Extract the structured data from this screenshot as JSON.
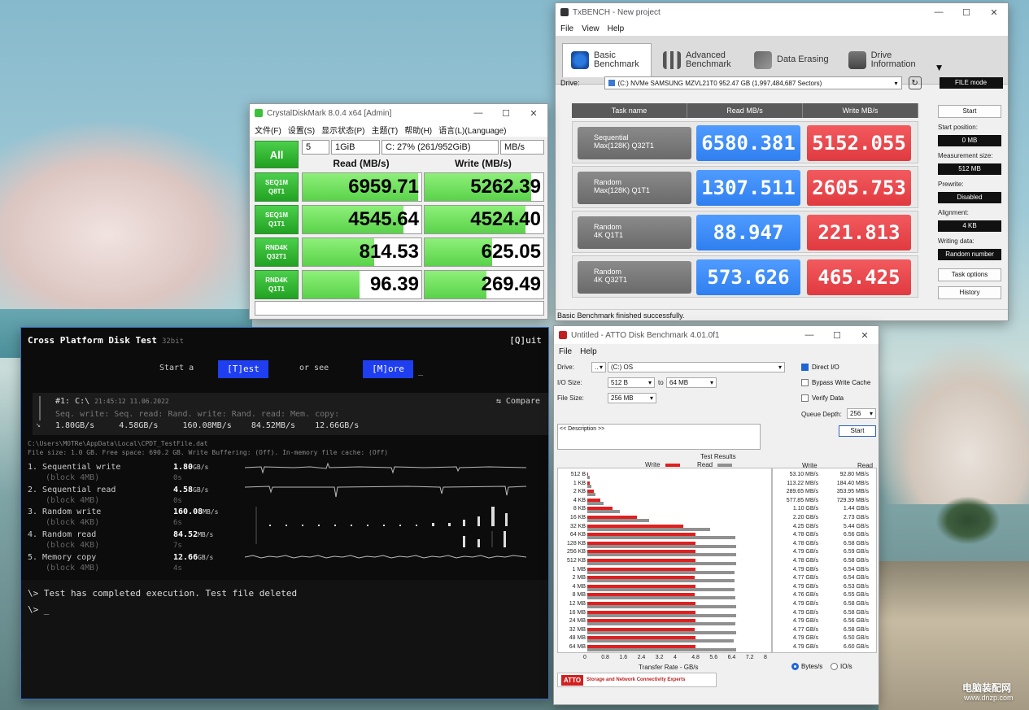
{
  "txbench": {
    "title": "TxBENCH - New project",
    "menu": [
      "File",
      "View",
      "Help"
    ],
    "tabs": [
      "Basic Benchmark",
      "Advanced Benchmark",
      "Data Erasing",
      "Drive Information"
    ],
    "drive_label": "Drive:",
    "drive_value": "(C:) NVMe SAMSUNG MZVL21T0  952.47 GB (1,997,484,687 Sectors)",
    "mode": "FILE mode",
    "headers": [
      "Task name",
      "Read MB/s",
      "Write MB/s"
    ],
    "rows": [
      {
        "name1": "Sequential",
        "name2": "Max(128K) Q32T1",
        "read": "6580.381",
        "write": "5152.055"
      },
      {
        "name1": "Random",
        "name2": "Max(128K) Q1T1",
        "read": "1307.511",
        "write": "2605.753"
      },
      {
        "name1": "Random",
        "name2": "4K Q1T1",
        "read": "88.947",
        "write": "221.813"
      },
      {
        "name1": "Random",
        "name2": "4K Q32T1",
        "read": "573.626",
        "write": "465.425"
      }
    ],
    "start": "Start",
    "start_position_label": "Start position:",
    "start_position": "0 MB",
    "measure_label": "Measurement size:",
    "measure": "512 MB",
    "prewrite_label": "Prewrite:",
    "prewrite": "Disabled",
    "align_label": "Alignment:",
    "align": "4 KB",
    "writing_label": "Writing data:",
    "writing": "Random number",
    "task_options": "Task options",
    "history": "History",
    "status": "Basic Benchmark finished successfully."
  },
  "cdm": {
    "title": "CrystalDiskMark 8.0.4 x64 [Admin]",
    "menu": [
      "文件(F)",
      "设置(S)",
      "显示状态(P)",
      "主题(T)",
      "帮助(H)",
      "语言(L)(Language)"
    ],
    "all": "All",
    "count": "5",
    "size": "1GiB",
    "drive": "C: 27% (261/952GiB)",
    "unit": "MB/s",
    "read_hdr": "Read (MB/s)",
    "write_hdr": "Write (MB/s)",
    "rows": [
      {
        "l1": "SEQ1M",
        "l2": "Q8T1",
        "read": "6959.71",
        "write": "5262.39",
        "rf": 0.97,
        "wf": 0.9
      },
      {
        "l1": "SEQ1M",
        "l2": "Q1T1",
        "read": "4545.64",
        "write": "4524.40",
        "rf": 0.85,
        "wf": 0.85
      },
      {
        "l1": "RND4K",
        "l2": "Q32T1",
        "read": "814.53",
        "write": "625.05",
        "rf": 0.6,
        "wf": 0.57
      },
      {
        "l1": "RND4K",
        "l2": "Q1T1",
        "read": "96.39",
        "write": "269.49",
        "rf": 0.48,
        "wf": 0.52
      }
    ]
  },
  "cpdt": {
    "title": "Cross Platform Disk Test",
    "bits": "32bit",
    "quit": "[Q]uit",
    "start": "Start a",
    "test": "[T]est",
    "orsee": "or see",
    "more": "[M]ore",
    "cursor": "_",
    "hist_head": "#1: C:\\",
    "hist_time": "21:45:12 11.06.2022",
    "compare": "⇆ Compare",
    "hist_labels": "Seq. write: Seq. read: Rand. write: Rand. read: Mem. copy:",
    "hist_values": "1.80GB/s     4.58GB/s     160.08MB/s    84.52MB/s    12.66GB/s",
    "path": "C:\\Users\\MOTRe\\AppData\\Local\\CPDT_TestFile.dat",
    "fileinfo": "File size: 1.0 GB. Free space: 690.2 GB. Write Buffering: (Off). In-memory file cache: (Off)",
    "results": [
      {
        "n": "1. Sequential write",
        "b": "(block 4MB)",
        "v": "1.80",
        "u": "GB/s",
        "t": "0s"
      },
      {
        "n": "2. Sequential read",
        "b": "(block 4MB)",
        "v": "4.58",
        "u": "GB/s",
        "t": "0s"
      },
      {
        "n": "3. Random write",
        "b": "(block 4KB)",
        "v": "160.08",
        "u": "MB/s",
        "t": "6s"
      },
      {
        "n": "4. Random read",
        "b": "(block 4KB)",
        "v": "84.52",
        "u": "MB/s",
        "t": "7s"
      },
      {
        "n": "5. Memory copy",
        "b": "(block 4MB)",
        "v": "12.66",
        "u": "GB/s",
        "t": "4s"
      }
    ],
    "done": "\\> Test has completed execution. Test file deleted",
    "prompt": "\\> _"
  },
  "atto": {
    "title": "Untitled - ATTO Disk Benchmark 4.01.0f1",
    "menu": [
      "File",
      "Help"
    ],
    "drive_label": "Drive:",
    "drive": "(C:) OS",
    "io_label": "I/O Size:",
    "io_from": "512 B",
    "to": "to",
    "io_to": "64 MB",
    "fs_label": "File Size:",
    "fs": "256 MB",
    "direct": "Direct I/O",
    "bypass": "Bypass Write Cache",
    "verify": "Verify Data",
    "qd_label": "Queue Depth:",
    "qd": "256",
    "desc": "<< Description >>",
    "start": "Start",
    "results_title": "Test Results",
    "write": "Write",
    "read": "Read",
    "col_write": "Write",
    "col_read": "Read",
    "xlabel": "Transfer Rate - GB/s",
    "ticks": [
      "0",
      "0.8",
      "1.6",
      "2.4",
      "3.2",
      "4",
      "4.8",
      "5.6",
      "6.4",
      "7.2",
      "8"
    ],
    "logo": "ATTO",
    "tagline": "Storage and Network Connectivity Experts",
    "units1": "Bytes/s",
    "units2": "IO/s",
    "chart_data": {
      "type": "bar",
      "categories": [
        "512 B",
        "1 KB",
        "2 KB",
        "4 KB",
        "8 KB",
        "16 KB",
        "32 KB",
        "64 KB",
        "128 KB",
        "256 KB",
        "512 KB",
        "1 MB",
        "2 MB",
        "4 MB",
        "8 MB",
        "12 MB",
        "16 MB",
        "24 MB",
        "32 MB",
        "48 MB",
        "64 MB"
      ],
      "write_labels": [
        "53.10 MB/s",
        "113.22 MB/s",
        "289.65 MB/s",
        "577.85 MB/s",
        "1.10 GB/s",
        "2.20 GB/s",
        "4.25 GB/s",
        "4.78 GB/s",
        "4.78 GB/s",
        "4.79 GB/s",
        "4.78 GB/s",
        "4.79 GB/s",
        "4.77 GB/s",
        "4.79 GB/s",
        "4.76 GB/s",
        "4.79 GB/s",
        "4.79 GB/s",
        "4.79 GB/s",
        "4.77 GB/s",
        "4.79 GB/s",
        "4.79 GB/s"
      ],
      "read_labels": [
        "92.80 MB/s",
        "184.40 MB/s",
        "353.95 MB/s",
        "729.39 MB/s",
        "1.44 GB/s",
        "2.73 GB/s",
        "5.44 GB/s",
        "6.56 GB/s",
        "6.58 GB/s",
        "6.59 GB/s",
        "6.58 GB/s",
        "6.54 GB/s",
        "6.54 GB/s",
        "6.53 GB/s",
        "6.55 GB/s",
        "6.58 GB/s",
        "6.58 GB/s",
        "6.56 GB/s",
        "6.58 GB/s",
        "6.50 GB/s",
        "6.60 GB/s"
      ],
      "series": [
        {
          "name": "Write",
          "values": [
            0.053,
            0.113,
            0.29,
            0.578,
            1.1,
            2.2,
            4.25,
            4.78,
            4.78,
            4.79,
            4.78,
            4.79,
            4.77,
            4.79,
            4.76,
            4.79,
            4.79,
            4.79,
            4.77,
            4.79,
            4.79
          ]
        },
        {
          "name": "Read",
          "values": [
            0.093,
            0.184,
            0.354,
            0.729,
            1.44,
            2.73,
            5.44,
            6.56,
            6.58,
            6.59,
            6.58,
            6.54,
            6.54,
            6.53,
            6.55,
            6.58,
            6.58,
            6.56,
            6.58,
            6.5,
            6.6
          ]
        }
      ],
      "xlim": [
        0,
        8
      ]
    }
  },
  "watermark": {
    "cn": "电脑装配网",
    "url": "www.dnzp.com"
  }
}
